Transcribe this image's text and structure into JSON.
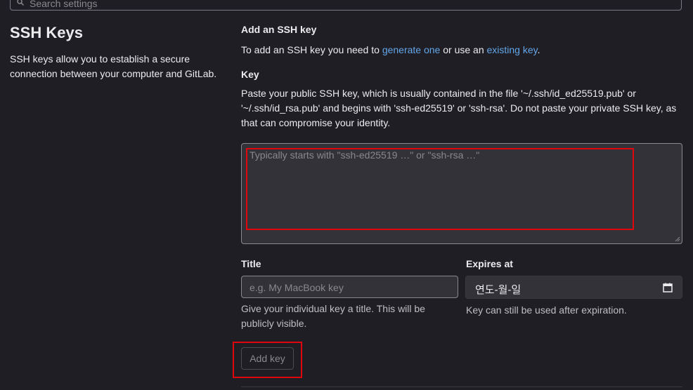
{
  "search": {
    "placeholder": "Search settings"
  },
  "sidebar": {
    "title": "SSH Keys",
    "description": "SSH keys allow you to establish a secure connection between your computer and GitLab."
  },
  "add_ssh": {
    "heading": "Add an SSH key",
    "text_before": "To add an SSH key you need to ",
    "link_generate": "generate one",
    "text_middle": " or use an ",
    "link_existing": "existing key",
    "text_after": "."
  },
  "key": {
    "heading": "Key",
    "description": "Paste your public SSH key, which is usually contained in the file '~/.ssh/id_ed25519.pub' or '~/.ssh/id_rsa.pub' and begins with 'ssh-ed25519' or 'ssh-rsa'. Do not paste your private SSH key, as that can compromise your identity.",
    "placeholder": "Typically starts with \"ssh-ed25519 …\" or \"ssh-rsa …\"",
    "value": ""
  },
  "title_field": {
    "label": "Title",
    "placeholder": "e.g. My MacBook key",
    "help": "Give your individual key a title. This will be publicly visible."
  },
  "expires_field": {
    "label": "Expires at",
    "value": "연도-월-일",
    "help": "Key can still be used after expiration."
  },
  "actions": {
    "add_key_label": "Add key"
  },
  "icons": {
    "search": "search-icon",
    "calendar": "calendar-icon",
    "resize": "resize-grip-icon"
  },
  "colors": {
    "background": "#1f1e24",
    "link": "#63a6e9",
    "highlight": "#e0060e",
    "input_bg": "#333238"
  }
}
